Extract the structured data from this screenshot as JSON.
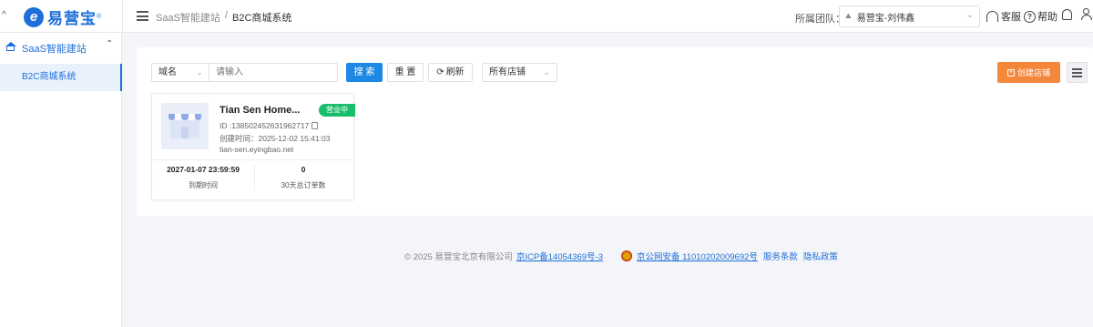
{
  "app": {
    "logo_text": "易营宝",
    "logo_mark": "e",
    "logo_reg": "®",
    "left_edge_glyph": "^"
  },
  "header": {
    "breadcrumb": [
      "SaaS智能建站",
      "/",
      "B2C商城系统"
    ],
    "team_label": "所属团队：",
    "team_value": "易营宝-刘伟鑫",
    "support_label": "客服",
    "help_label": "帮助"
  },
  "sidebar": {
    "group_label": "SaaS智能建站",
    "items": [
      {
        "label": "B2C商城系统",
        "active": true
      }
    ]
  },
  "filters": {
    "field_select": "域名",
    "search_placeholder": "请输入",
    "search_button": "搜 索",
    "reset_button": "重 置",
    "refresh_button": "刷新",
    "store_select": "所有店铺",
    "create_button": "创建店铺"
  },
  "stores": [
    {
      "name": "Tian Sen Home...",
      "status": "营业中",
      "id_text": "ID :138502452631962717",
      "created_text": "创建时间：2025-12-02 15:41:03",
      "domain": "tian-sen.eyingbao.net",
      "expire_value": "2027-01-07 23:59:59",
      "expire_label": "到期时间",
      "orders_value": "0",
      "orders_label": "30天总订单数"
    }
  ],
  "footer": {
    "copyright": "© 2025 易营宝北京有限公司",
    "icp_link": "京ICP备14054369号-3",
    "police_link": "京公网安备 11010202009692号",
    "terms_link": "服务条款",
    "privacy_link": "隐私政策"
  },
  "colors": {
    "primary": "#1e88e5",
    "brand": "#1e6fd9",
    "create_button": "#f5873b",
    "status_open": "#19be6b"
  }
}
